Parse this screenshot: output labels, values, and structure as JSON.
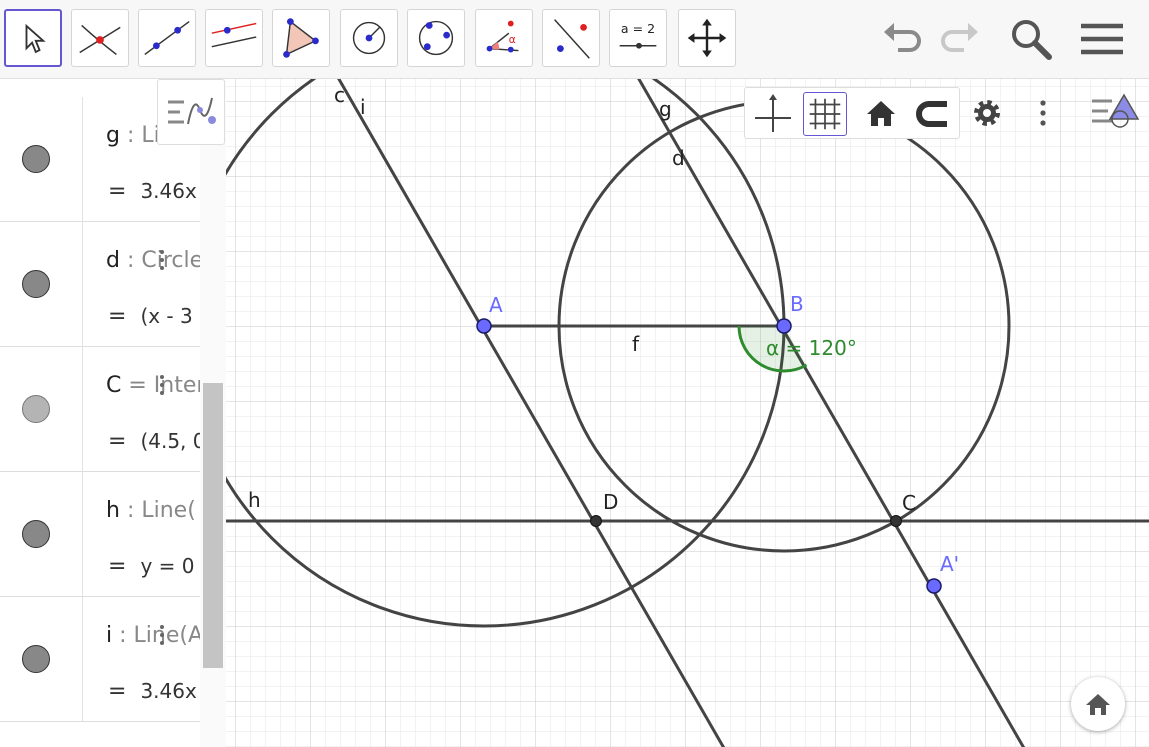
{
  "toolbar": {
    "tools": [
      {
        "name": "move-tool",
        "icon": "arrow-cursor-icon"
      },
      {
        "name": "intersect-tool",
        "icon": "intersect-icon"
      },
      {
        "name": "line-tool",
        "icon": "line-through-two-points-icon"
      },
      {
        "name": "parallel-tool",
        "icon": "parallel-line-icon"
      },
      {
        "name": "polygon-tool",
        "icon": "polygon-icon"
      },
      {
        "name": "circle-tool",
        "icon": "circle-center-point-icon"
      },
      {
        "name": "circle-three-points-tool",
        "icon": "circle-through-points-icon"
      },
      {
        "name": "angle-tool",
        "icon": "angle-icon",
        "label": "α"
      },
      {
        "name": "reflect-tool",
        "icon": "reflect-about-line-icon"
      },
      {
        "name": "slider-tool",
        "icon": "slider-icon",
        "label": "a = 2"
      },
      {
        "name": "move-graphics-tool",
        "icon": "move-arrows-icon"
      }
    ],
    "right_buttons": [
      "undo-icon",
      "redo-icon",
      "search-icon",
      "menu-icon"
    ]
  },
  "algebra": {
    "rows": [
      {
        "def_name": "g",
        "def_rest": " : Line(",
        "value": "3.46x",
        "marble": "dark"
      },
      {
        "def_name": "d",
        "def_rest": " : Circle",
        "value": "(x - 3",
        "marble": "dark"
      },
      {
        "def_name": "C",
        "def_rest": " = Inter",
        "value": "(4.5, 0",
        "marble": "light"
      },
      {
        "def_name": "h",
        "def_rest": " : Line(",
        "value": "y = 0",
        "marble": "dark"
      },
      {
        "def_name": "i",
        "def_rest": " : Line(A",
        "value": "3.46x",
        "marble": "dark"
      }
    ]
  },
  "graphics": {
    "style_bar": [
      "axes-icon",
      "grid-icon",
      "home-icon",
      "magnet-icon",
      "gear-icon",
      "more-vertical-icon"
    ],
    "style_toggle_icon": "graphics-style-icon",
    "labels": {
      "A": "A",
      "B": "B",
      "C": "C",
      "D": "D",
      "A_prime": "A'",
      "c": "c",
      "i": "i",
      "g": "g",
      "d": "d",
      "f": "f",
      "h": "h",
      "angle": "α = 120°"
    },
    "colors": {
      "free_point": "#6a6aff",
      "dependent_point": "#333333",
      "angle": "#2e8b2e",
      "line": "#444444"
    }
  }
}
